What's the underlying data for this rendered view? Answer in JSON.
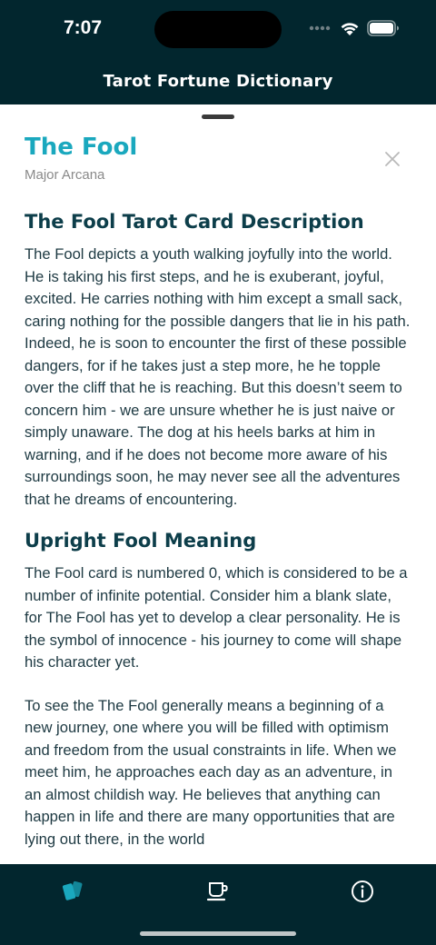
{
  "status_bar": {
    "time": "7:07"
  },
  "nav": {
    "title": "Tarot Fortune Dictionary"
  },
  "card": {
    "title": "The Fool",
    "subtitle": "Major Arcana"
  },
  "sections": [
    {
      "heading": "The Fool Tarot Card Description",
      "paragraphs": [
        "The Fool depicts a youth walking joyfully into the world. He is taking his first steps, and he is exuberant, joyful, excited. He carries nothing with him except a small sack, caring nothing for the possible dangers that lie in his path. Indeed, he is soon to encounter the first of these possible dangers, for if he takes just a step more, he he topple over the cliff that he is reaching. But this doesn’t seem to concern him - we are unsure whether he is just naive or simply unaware. The dog at his heels barks at him in warning, and if he does not become more aware of his surroundings soon, he may never see all the adventures that he dreams of encountering."
      ]
    },
    {
      "heading": "Upright Fool Meaning",
      "paragraphs": [
        "The Fool card is numbered 0, which is considered to be a number of infinite potential. Consider him a blank slate, for The Fool has yet to develop a clear personality. He is the symbol of innocence - his journey to come will shape his character yet.",
        "To see the The Fool generally means a beginning of a new journey, one where you will be filled with optimism and freedom from the usual constraints in life. When we meet him, he approaches each day as an adventure, in an almost childish way. He believes that anything can happen in life and there are many opportunities that are lying out there, in the world"
      ]
    }
  ],
  "tabs": [
    {
      "icon": "cards-icon",
      "active": true
    },
    {
      "icon": "coffee-cup-icon",
      "active": false
    },
    {
      "icon": "info-icon",
      "active": false
    }
  ],
  "colors": {
    "dark_bg": "#02262e",
    "accent": "#1aa8be",
    "heading": "#0d3e4a",
    "body_text": "#1d3942",
    "subtitle": "#8a8a8a"
  }
}
